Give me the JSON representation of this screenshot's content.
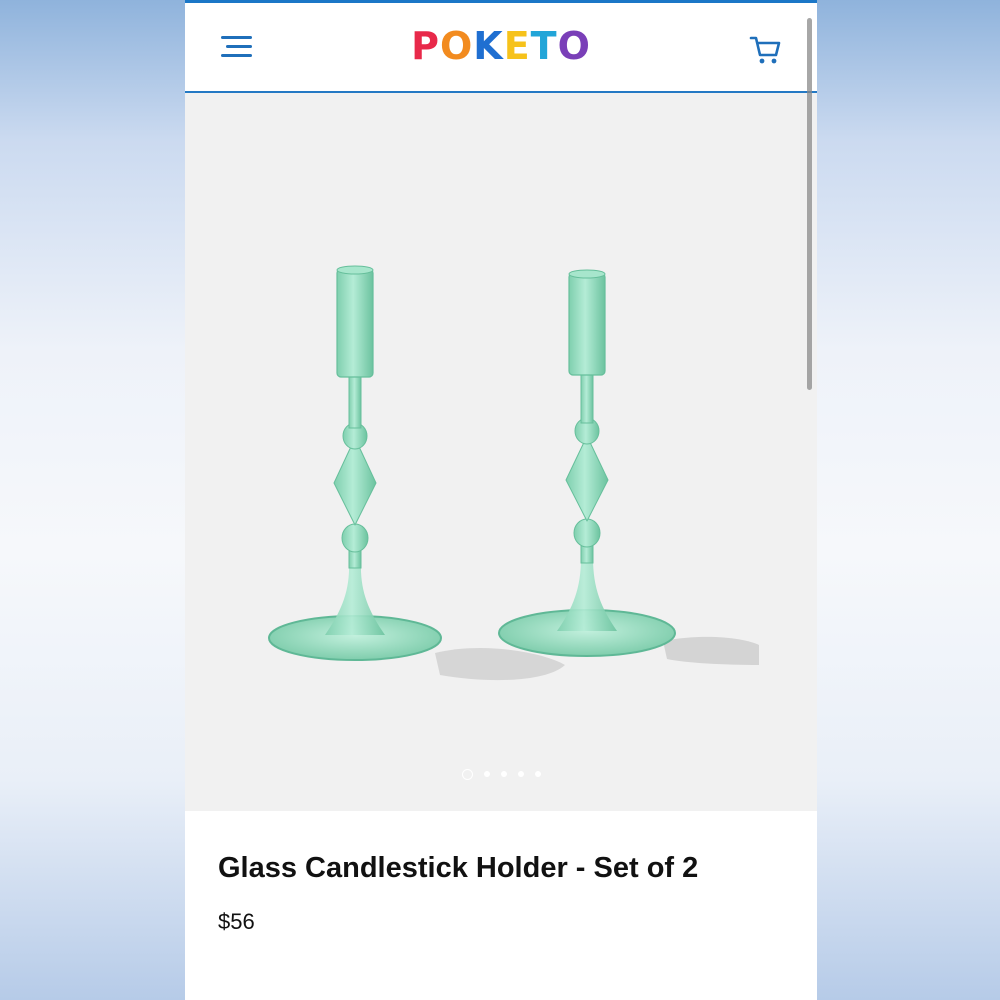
{
  "header": {
    "menu_icon": "hamburger-menu-icon",
    "logo_letters": [
      "P",
      "O",
      "K",
      "E",
      "T",
      "O"
    ],
    "cart_icon": "shopping-cart-icon",
    "accent_color": "#2479c4"
  },
  "gallery": {
    "image_description_icon": "glass-candlestick-holders-image",
    "glass_color": "#8fd9bd",
    "slide_count": 5,
    "active_slide": 1
  },
  "product": {
    "title": "Glass Candlestick Holder - Set of 2",
    "price": "$56"
  }
}
